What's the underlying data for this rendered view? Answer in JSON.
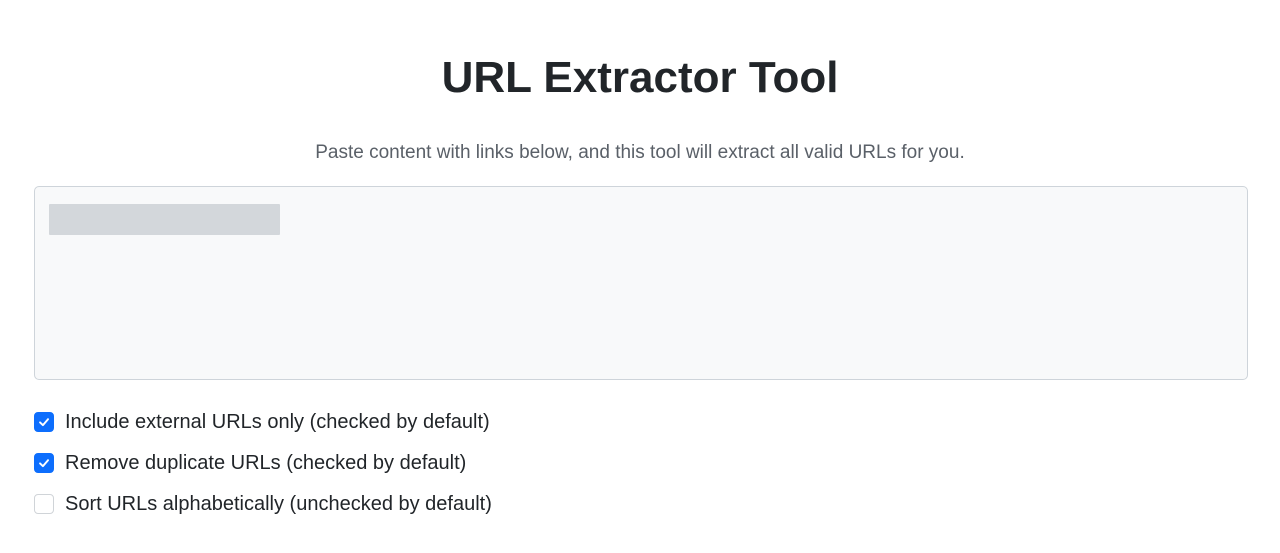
{
  "header": {
    "title": "URL Extractor Tool",
    "subtitle": "Paste content with links below, and this tool will extract all valid URLs for you."
  },
  "input": {
    "value": "",
    "placeholder": ""
  },
  "options": [
    {
      "label": "Include external URLs only (checked by default)",
      "checked": true
    },
    {
      "label": "Remove duplicate URLs (checked by default)",
      "checked": true
    },
    {
      "label": "Sort URLs alphabetically (unchecked by default)",
      "checked": false
    }
  ],
  "colors": {
    "accent": "#0d6efd",
    "text": "#212529",
    "muted_text": "#5a6068",
    "input_background": "#f8f9fa",
    "input_border": "#ced4da"
  },
  "icons": {
    "checkmark": "checkmark-icon"
  }
}
